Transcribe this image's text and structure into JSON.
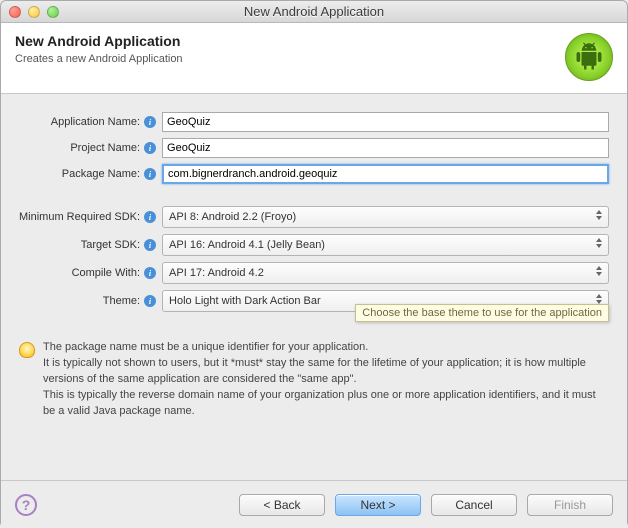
{
  "window": {
    "title": "New Android Application"
  },
  "header": {
    "title": "New Android Application",
    "subtitle": "Creates a new Android Application"
  },
  "fields": {
    "app_name": {
      "label": "Application Name:",
      "value": "GeoQuiz"
    },
    "project_name": {
      "label": "Project Name:",
      "value": "GeoQuiz"
    },
    "package_name": {
      "label": "Package Name:",
      "value": "com.bignerdranch.android.geoquiz"
    },
    "min_sdk": {
      "label": "Minimum Required SDK:",
      "value": "API 8: Android 2.2 (Froyo)"
    },
    "target_sdk": {
      "label": "Target SDK:",
      "value": "API 16: Android 4.1 (Jelly Bean)"
    },
    "compile_with": {
      "label": "Compile With:",
      "value": "API 17: Android 4.2"
    },
    "theme": {
      "label": "Theme:",
      "value": "Holo Light with Dark Action Bar"
    }
  },
  "tooltip": "Choose the base theme to use for the application",
  "note": "The package name must be a unique identifier for your application.\nIt is typically not shown to users, but it *must* stay the same for the lifetime of your application; it is how multiple versions of the same application are considered the \"same app\".\nThis is typically the reverse domain name of your organization plus one or more application identifiers, and it must be a valid Java package name.",
  "buttons": {
    "back": "< Back",
    "next": "Next >",
    "cancel": "Cancel",
    "finish": "Finish"
  }
}
